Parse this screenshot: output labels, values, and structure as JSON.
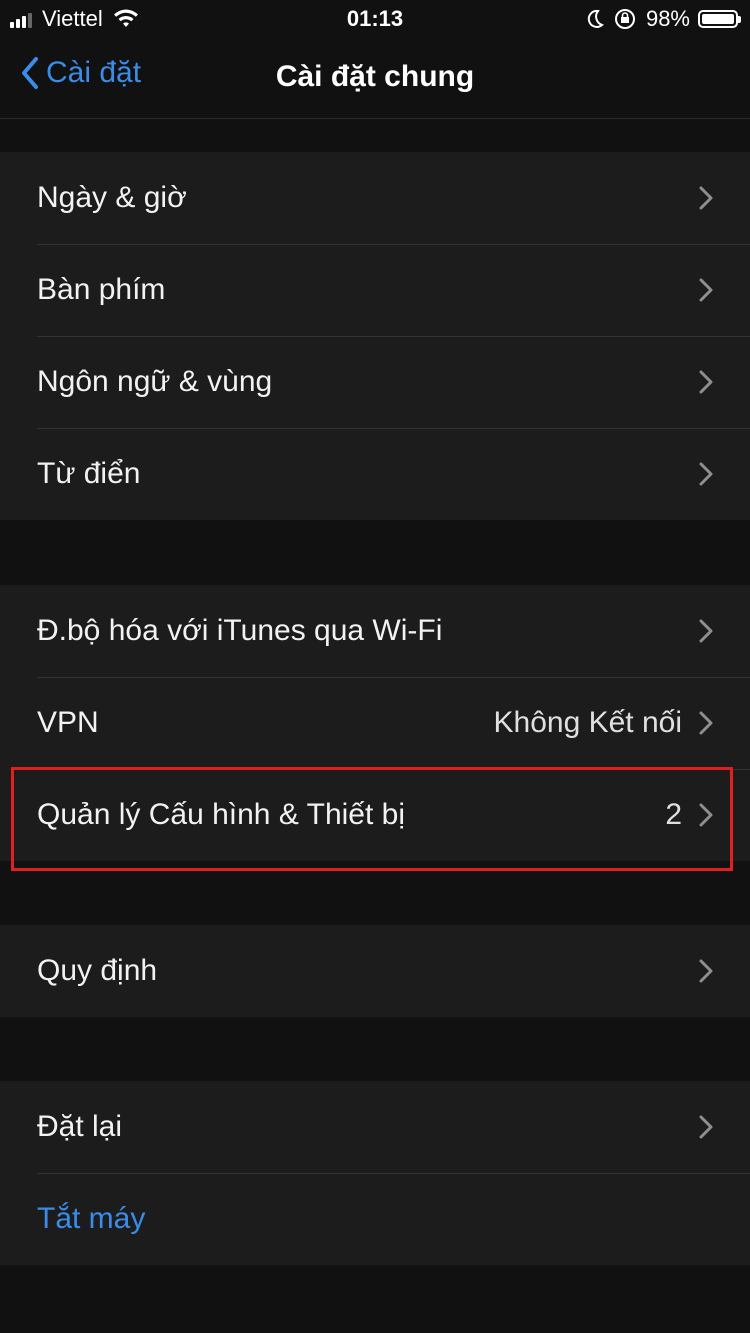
{
  "status_bar": {
    "carrier": "Viettel",
    "time": "01:13",
    "battery": "98%",
    "battery_level": 0.98
  },
  "nav": {
    "back_label": "Cài đặt",
    "title": "Cài đặt chung"
  },
  "groups": [
    {
      "rows": [
        {
          "label": "Ngày & giờ"
        },
        {
          "label": "Bàn phím"
        },
        {
          "label": "Ngôn ngữ & vùng"
        },
        {
          "label": "Từ điển"
        }
      ]
    },
    {
      "rows": [
        {
          "label": "Đ.bộ hóa với iTunes qua Wi-Fi"
        },
        {
          "label": "VPN",
          "value": "Không Kết nối"
        },
        {
          "label": "Quản lý Cấu hình & Thiết bị",
          "value": "2"
        }
      ]
    },
    {
      "rows": [
        {
          "label": "Quy định"
        }
      ]
    },
    {
      "rows": [
        {
          "label": "Đặt lại"
        },
        {
          "label": "Tắt máy"
        }
      ]
    }
  ],
  "colors": {
    "background": "#111111",
    "cell": "#1c1c1c",
    "accent": "#3b8ce8",
    "highlight": "#e02020"
  }
}
